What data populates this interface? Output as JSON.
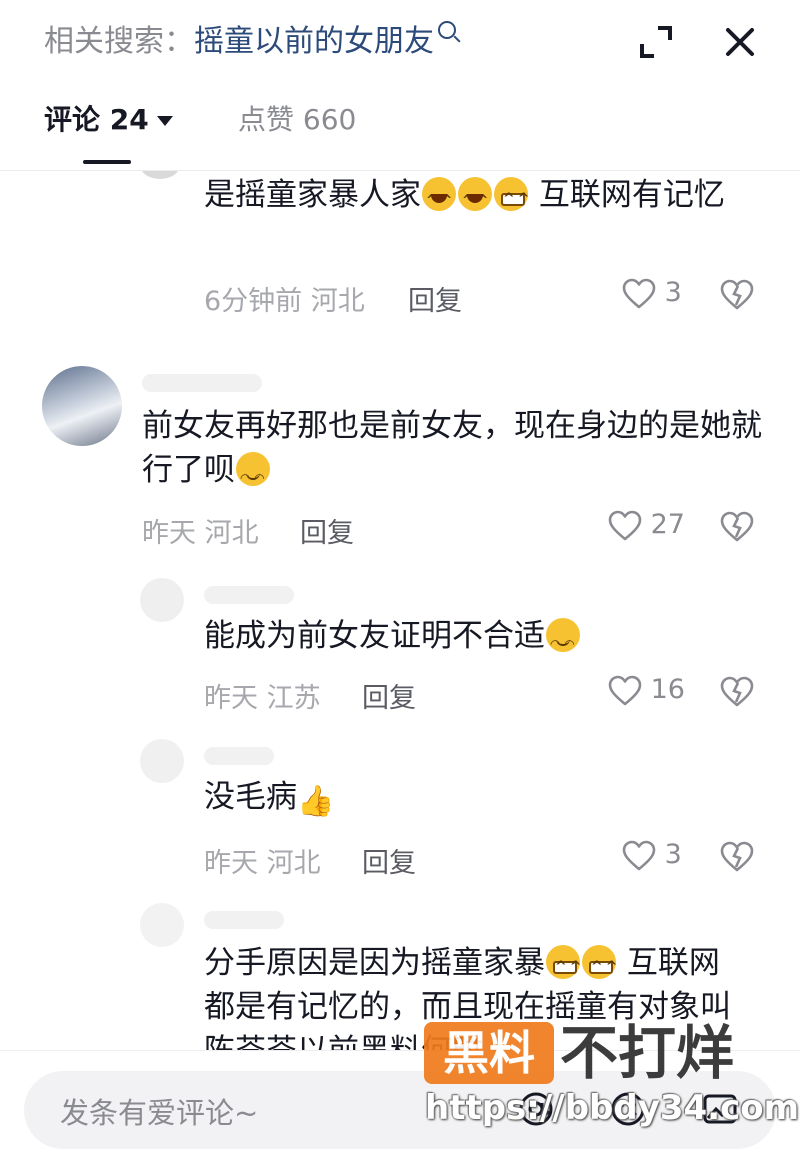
{
  "header": {
    "related_label": "相关搜索：",
    "related_query": "摇童以前的女朋友",
    "tabs": {
      "comments_label": "评论",
      "comments_count": "24",
      "likes_label": "点赞",
      "likes_count": "660"
    }
  },
  "comments": [
    {
      "text_before": "是摇童家暴人家",
      "emojis": [
        "laugh-cry",
        "laugh-cry",
        "grin"
      ],
      "text_after": "互联网有记忆",
      "time": "6分钟前",
      "location": "河北",
      "reply_label": "回复",
      "likes": "3"
    },
    {
      "text_before": "前女友再好那也是前女友，现在身边的是她就行了呗",
      "emojis": [
        "smug"
      ],
      "text_after": "",
      "time": "昨天",
      "location": "河北",
      "reply_label": "回复",
      "likes": "27"
    },
    {
      "text_before": "能成为前女友证明不合适",
      "emojis": [
        "smug"
      ],
      "text_after": "",
      "time": "昨天",
      "location": "江苏",
      "reply_label": "回复",
      "likes": "16"
    },
    {
      "text_before": "没毛病",
      "emojis": [
        "thumbs-up"
      ],
      "text_after": "",
      "time": "昨天",
      "location": "河北",
      "reply_label": "回复",
      "likes": "3"
    },
    {
      "text_before": "分手原因是因为摇童家暴",
      "emojis": [
        "grin",
        "grin"
      ],
      "text_after": "互联网都是有记忆的，而且现在摇童有对象叫陈荃荃以前黑料何时",
      "time": "",
      "location": "",
      "reply_label": "",
      "likes": ""
    }
  ],
  "footer": {
    "input_placeholder": "发条有爱评论~"
  },
  "watermark": {
    "badge": "黑料",
    "text": "不打烊",
    "url": "https://bbdy34.com",
    "badge_color": "#f07b1c"
  },
  "colors": {
    "query_link": "#2c4a7a",
    "text_primary": "#161823",
    "text_secondary": "#a7a8ad"
  },
  "icons": [
    "search-icon",
    "collapse-icon",
    "close-icon",
    "heart-icon",
    "dislike-icon",
    "at-icon",
    "emoji-icon",
    "image-icon"
  ]
}
